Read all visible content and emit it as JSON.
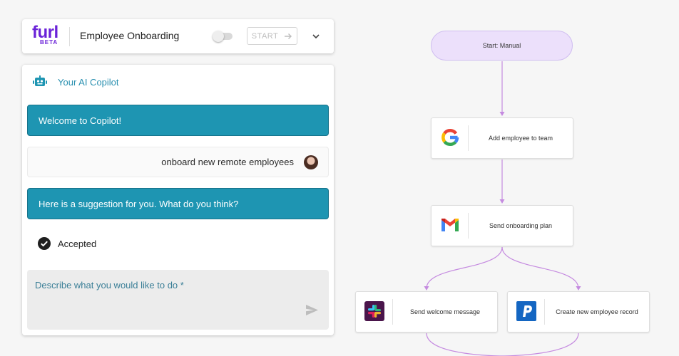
{
  "header": {
    "logo_word": "furl",
    "logo_badge": "BETA",
    "flow_title": "Employee Onboarding",
    "start_label": "START"
  },
  "copilot": {
    "title": "Your AI Copilot",
    "messages": [
      {
        "role": "ai",
        "text": "Welcome to Copilot!"
      },
      {
        "role": "user",
        "text": "onboard new remote employees"
      },
      {
        "role": "ai",
        "text": "Here is a suggestion for you. What do you think?"
      }
    ],
    "status": "Accepted",
    "input_placeholder": "Describe what you would like to do *",
    "input_value": ""
  },
  "flow": {
    "start_node": "Start: Manual",
    "steps": [
      {
        "icon": "google-icon",
        "label": "Add employee to team"
      },
      {
        "icon": "gmail-icon",
        "label": "Send onboarding plan"
      },
      {
        "icon": "slack-icon",
        "label": "Send welcome message"
      },
      {
        "icon": "paypal-icon",
        "label": "Create new employee record"
      }
    ]
  },
  "colors": {
    "brand": "#6a22d8",
    "ai_bubble": "#1e95b2",
    "copilot_accent": "#2a90b0",
    "connector": "#c58be0",
    "start_node_bg": "#ece0fb",
    "background": "#f6f6f6"
  }
}
